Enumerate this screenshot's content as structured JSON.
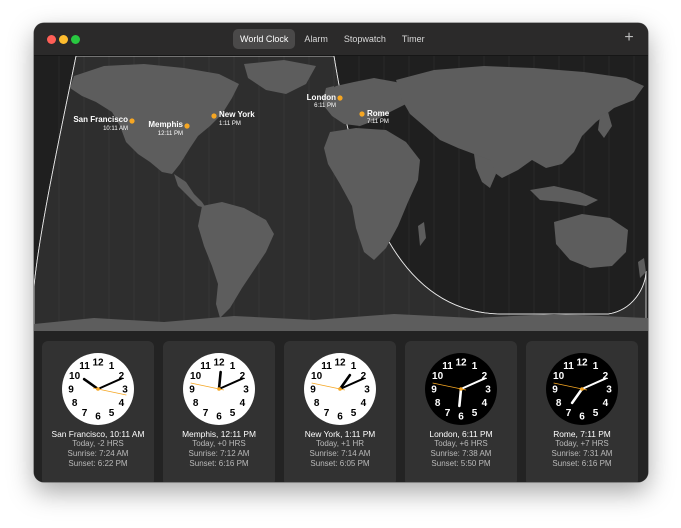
{
  "window": {
    "tabs": [
      {
        "label": "World Clock",
        "active": true
      },
      {
        "label": "Alarm",
        "active": false
      },
      {
        "label": "Stopwatch",
        "active": false
      },
      {
        "label": "Timer",
        "active": false
      }
    ],
    "add_label": "+"
  },
  "map": {
    "cities": [
      {
        "name": "San Francisco",
        "time": "10:11 AM"
      },
      {
        "name": "Memphis",
        "time": "12:11 PM"
      },
      {
        "name": "New York",
        "time": "1:11 PM"
      },
      {
        "name": "London",
        "time": "6:11 PM"
      },
      {
        "name": "Rome",
        "time": "7:11 PM"
      }
    ],
    "marker_color": "#f5a623"
  },
  "clocks": [
    {
      "title": "San Francisco, 10:11 AM",
      "offset": "Today, -2 HRS",
      "sunrise": "Sunrise: 7:24 AM",
      "sunset": "Sunset: 6:22 PM",
      "hour": 10,
      "minute": 11,
      "second": 17,
      "face": "light"
    },
    {
      "title": "Memphis, 12:11 PM",
      "offset": "Today, +0 HRS",
      "sunrise": "Sunrise: 7:12 AM",
      "sunset": "Sunset: 6:16 PM",
      "hour": 12,
      "minute": 11,
      "second": 47,
      "face": "light"
    },
    {
      "title": "New York, 1:11 PM",
      "offset": "Today, +1 HR",
      "sunrise": "Sunrise: 7:14 AM",
      "sunset": "Sunset: 6:05 PM",
      "hour": 13,
      "minute": 11,
      "second": 47,
      "face": "light"
    },
    {
      "title": "London, 6:11 PM",
      "offset": "Today, +6 HRS",
      "sunrise": "Sunrise: 7:38 AM",
      "sunset": "Sunset: 5:50 PM",
      "hour": 18,
      "minute": 11,
      "second": 47,
      "face": "dark"
    },
    {
      "title": "Rome, 7:11 PM",
      "offset": "Today, +7 HRS",
      "sunrise": "Sunrise: 7:31 AM",
      "sunset": "Sunset: 6:16 PM",
      "hour": 19,
      "minute": 11,
      "second": 47,
      "face": "dark"
    }
  ],
  "dial_numbers": [
    "12",
    "1",
    "2",
    "3",
    "4",
    "5",
    "6",
    "7",
    "8",
    "9",
    "10",
    "11"
  ],
  "colors": {
    "second_hand": "#f5a623",
    "window_bg": "#1e1e1e",
    "card_bg": "#323232"
  }
}
